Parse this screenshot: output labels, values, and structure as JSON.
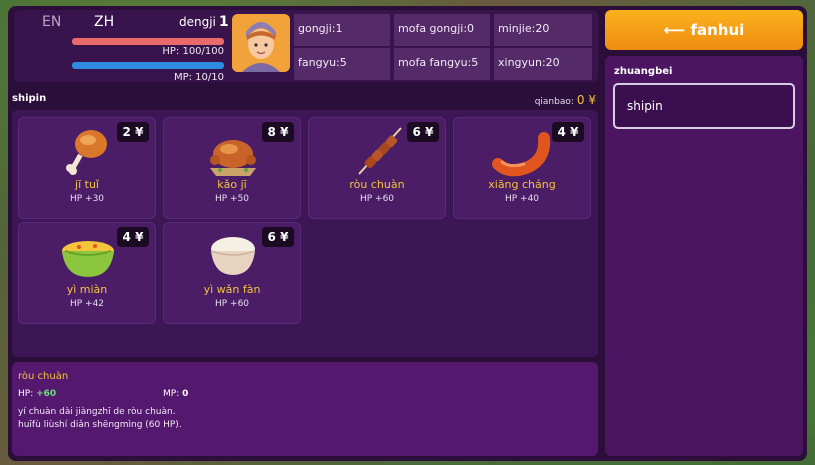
{
  "header": {
    "lang_en": "EN",
    "lang_zh": "ZH",
    "dengji_label": "dengji",
    "dengji_value": "1",
    "hp_text": "HP: 100/100",
    "mp_text": "MP: 10/10",
    "hp_ratio": 1.0,
    "mp_ratio": 1.0
  },
  "stats": {
    "gongji": "gongji:1",
    "mofa_gongji": "mofa gongji:0",
    "minjie": "minjie:20",
    "fangyu": "fangyu:5",
    "mofa_fangyu": "mofa fangyu:5",
    "xingyun": "xingyun:20"
  },
  "shop": {
    "title": "shipin",
    "qianbao_label": "qianbao:",
    "qianbao_amount": "0 ¥"
  },
  "items": [
    {
      "price": "2 ¥",
      "name": "jī tuǐ",
      "effect": "HP +30"
    },
    {
      "price": "8 ¥",
      "name": "kǎo jī",
      "effect": "HP +50"
    },
    {
      "price": "6 ¥",
      "name": "ròu chuàn",
      "effect": "HP +60"
    },
    {
      "price": "4 ¥",
      "name": "xiāng cháng",
      "effect": "HP +40"
    },
    {
      "price": "4 ¥",
      "name": "yì miàn",
      "effect": "HP +42"
    },
    {
      "price": "6 ¥",
      "name": "yì wǎn fàn",
      "effect": "HP +60"
    }
  ],
  "detail": {
    "name": "ròu chuàn",
    "hp_label": "HP:",
    "hp_value": "+60",
    "mp_label": "MP:",
    "mp_value": "0",
    "desc_line1": "yí chuàn dài jiàngzhī de ròu chuàn.",
    "desc_line2": "huīfù liùshí diǎn shēngmìng (60 HP)."
  },
  "right": {
    "back_label": "⟵ fanhui",
    "equip_title": "zhuangbei",
    "equip_value": "shipin"
  },
  "colors": {
    "accent_gold": "#f5c43a",
    "back_button": "#f59e17",
    "hp_bar": "#e86a6a",
    "mp_bar": "#2f8be0",
    "hp_bonus": "#6ee07a"
  },
  "icons": [
    "drumstick-icon",
    "roast-chicken-icon",
    "meat-skewer-icon",
    "sausage-icon",
    "noodle-bowl-icon",
    "rice-bowl-icon",
    "hero-portrait"
  ]
}
